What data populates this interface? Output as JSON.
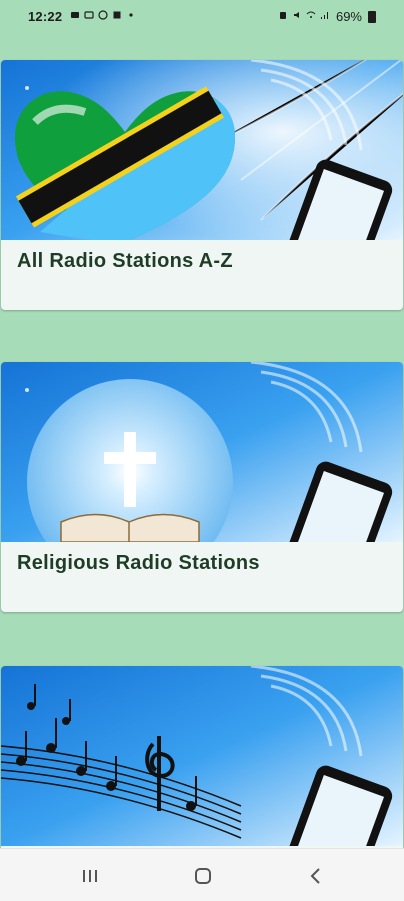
{
  "status_bar": {
    "time": "12:22",
    "battery_percent": "69%",
    "left_icons": [
      "notification-icon",
      "message-icon",
      "whatsapp-icon",
      "app-icon"
    ],
    "right_icons": [
      "alarm-icon",
      "mute-icon",
      "wifi-icon",
      "signal-icon"
    ]
  },
  "cards": [
    {
      "label": "All Radio Stations A-Z",
      "banner": "tanzania-flag-heart"
    },
    {
      "label": "Religious Radio Stations",
      "banner": "cross-bible"
    },
    {
      "label": "",
      "banner": "music-notes"
    }
  ],
  "nav": {
    "recent_icon": "recent-apps-icon",
    "home_icon": "home-icon",
    "back_icon": "back-icon"
  },
  "colors": {
    "background": "#a7dcb9",
    "card": "#eff6f3",
    "label": "#1f3d26",
    "sky": "#2a8fe3"
  }
}
